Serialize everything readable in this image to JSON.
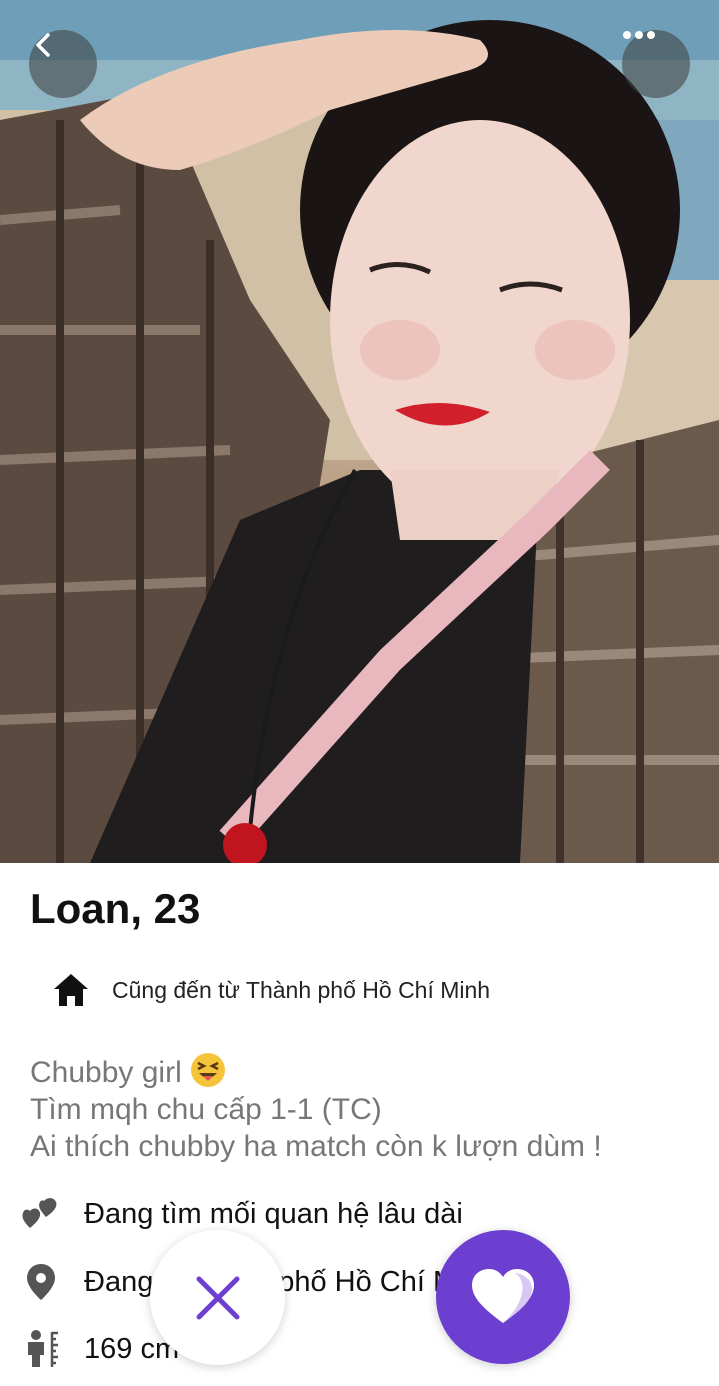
{
  "profile": {
    "name_age": "Loan, 23",
    "hometown": "Cũng đến từ Thành phố Hồ Chí Minh",
    "bio_lines": [
      "Chubby girl",
      "Tìm mqh chu cấp 1-1 (TC)",
      "Ai thích chubby ha match còn k lượn dùm !"
    ],
    "attributes": [
      {
        "icon": "hearts-icon",
        "label": "Đang tìm mối quan hệ lâu dài"
      },
      {
        "icon": "location-pin-icon",
        "label": "Đang ở Thành phố Hồ Chí Minh"
      },
      {
        "icon": "height-icon",
        "label": "169 cm"
      }
    ]
  },
  "header": {
    "back_icon": "chevron-left-icon",
    "more_icon": "more-dots-icon"
  },
  "actions": {
    "pass_icon": "close-x-icon",
    "like_icon": "heart-icon"
  },
  "colors": {
    "accent": "#6c3fd0",
    "bio_text": "#777777"
  }
}
